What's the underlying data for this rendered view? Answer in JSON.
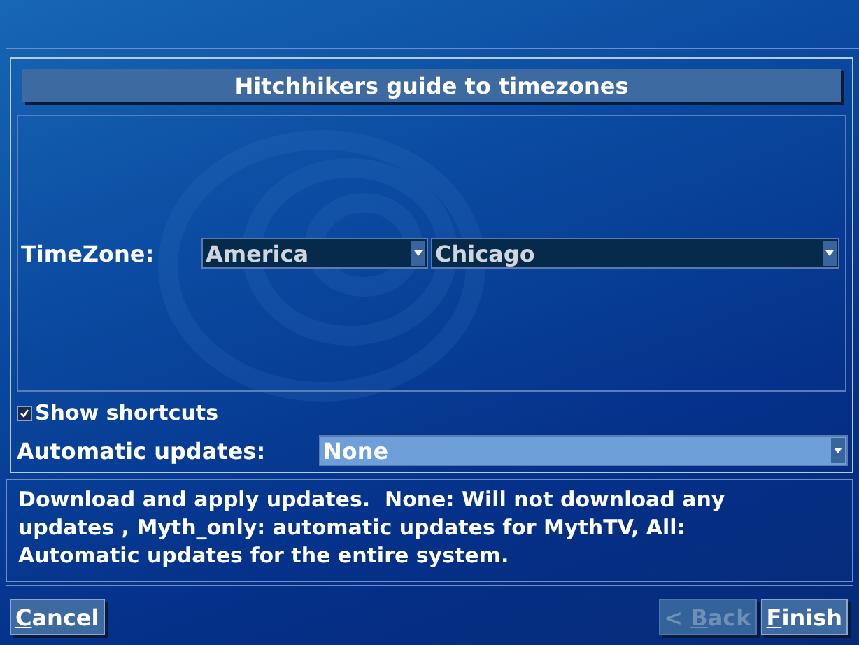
{
  "dialog": {
    "title": "Hitchhikers guide to timezones"
  },
  "timezone": {
    "label": "TimeZone:",
    "region": {
      "value": "America",
      "focused": false
    },
    "city": {
      "value": "Chicago",
      "focused": false
    }
  },
  "show_shortcuts": {
    "label": "Show shortcuts",
    "checked": true
  },
  "automatic_updates": {
    "label": "Automatic updates:",
    "value": "None",
    "focused": true
  },
  "help_text": "Download and apply updates.  None: Will not download any updates , Myth_only: automatic updates for MythTV, All: Automatic updates for the entire system.",
  "buttons": [
    {
      "mnemonic": "C",
      "rest": "ancel",
      "disabled": false
    },
    {
      "mnemonic": "B",
      "rest": "ack",
      "prefix": "< ",
      "disabled": true
    },
    {
      "mnemonic": "F",
      "rest": "inish",
      "disabled": false
    }
  ]
}
